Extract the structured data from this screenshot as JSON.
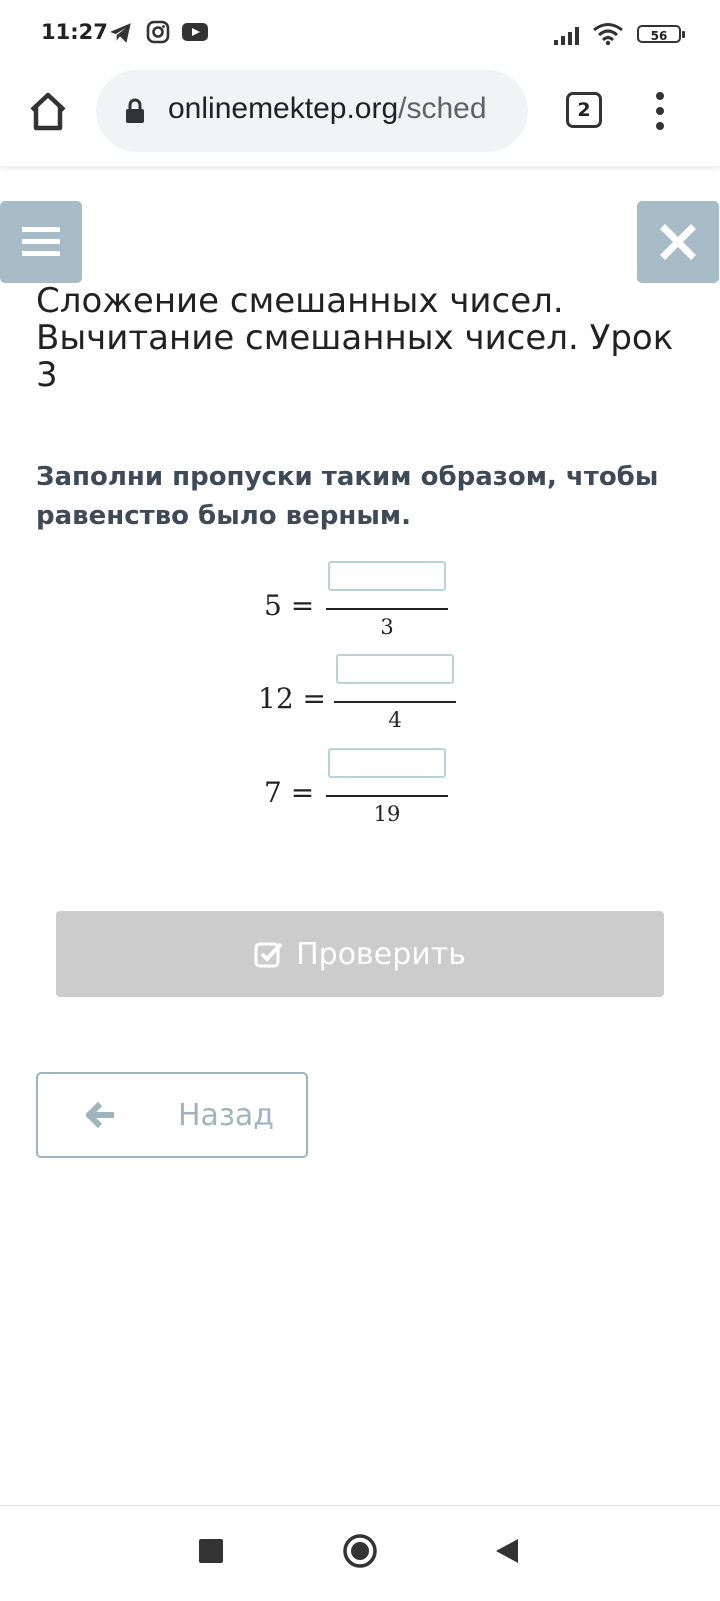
{
  "status_bar": {
    "time": "11:27",
    "battery": "56",
    "icons": [
      "telegram-icon",
      "instagram-icon",
      "youtube-icon",
      "signal-icon",
      "wifi-icon",
      "battery-icon"
    ]
  },
  "browser": {
    "url_domain": "onlinemektep.org",
    "url_path": "/sched",
    "tab_count": "2"
  },
  "page": {
    "title": "Сложение смешанных чисел. Вычитание смешанных чисел. Урок 3",
    "instruction": "Заполни пропуски таким образом, чтобы равенство было верным.",
    "equations": [
      {
        "lhs": "5 =",
        "numerator_value": "",
        "denominator": "3"
      },
      {
        "lhs": "12 =",
        "numerator_value": "",
        "denominator": "4"
      },
      {
        "lhs": "7 =",
        "numerator_value": "",
        "denominator": "19"
      }
    ],
    "check_button": "Проверить",
    "back_button": "Назад"
  },
  "colors": {
    "side_button_bg": "#a7bcc6",
    "check_button_bg": "#cccccc",
    "back_border": "#9fb4bf",
    "instruction_text": "#3e4a57"
  }
}
